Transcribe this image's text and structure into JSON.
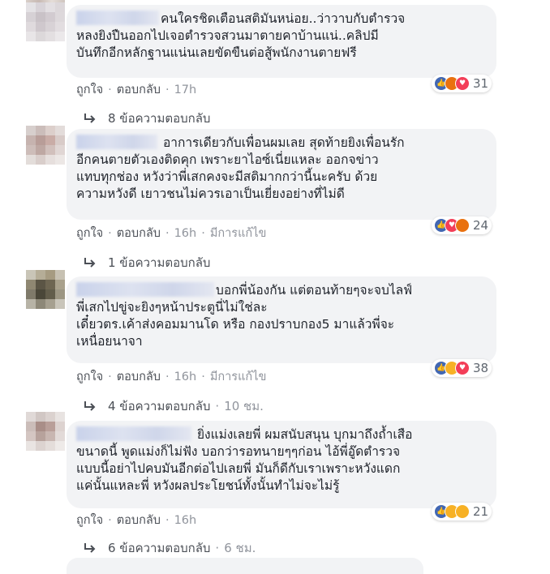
{
  "comments": [
    {
      "text_lines": [
        "คนใครชิดเตือนสติมันหน่อย..ว่าวาบกับตำรวจ",
        "หลงยิงปืนออกไปเจอตำรวจสวนมาตายคาบ้านแน่..คลิปมี",
        "บันทึกอีกหลักฐานแน่นเลยขัดขืนต่อสู้พนักงานตายฟรี"
      ],
      "like_label": "ถูกใจ",
      "reply_label": "ตอบกลับ",
      "time": "17h",
      "edited": "",
      "reactions": [
        "like",
        "angry",
        "love"
      ],
      "reaction_count": "31",
      "replies_label": "8 ข้อความตอบกลับ",
      "replies_time": ""
    },
    {
      "text_lines": [
        "อาการเดียวกับเพื่อนผมเลย สุดท้ายยิงเพื่อนรัก",
        "อีกคนตายตัวเองติดคุก เพราะยาไอซ์เนี่ยแหละ ออกจข่าว",
        "แทบทุกช่อง หวังว่าพี่เสกคงจะมีสติมากกว่านี้นะครับ ด้วย",
        "ความหวังดี เยาวชนไม่ควรเอาเป็นเยี่ยงอย่างที่ไม่ดี"
      ],
      "like_label": "ถูกใจ",
      "reply_label": "ตอบกลับ",
      "time": "16h",
      "edited": "มีการแก้ไข",
      "reactions": [
        "like",
        "love",
        "angry"
      ],
      "reaction_count": "24",
      "replies_label": "1 ข้อความตอบกลับ",
      "replies_time": ""
    },
    {
      "text_lines": [
        "บอกพี่น้องกัน แต่ตอนท้ายๆจะจบไลฟ์",
        "พี่เสกไปขู่จะยิงๆหน้าประตูนี่ไม่ใช่ละ",
        "เดี๋ยวตร.เค้าส่งคอมมานโด หรือ กองปราบกอง5 มาแล้วพี่จะ",
        "เหนื่อยนาจา"
      ],
      "like_label": "ถูกใจ",
      "reply_label": "ตอบกลับ",
      "time": "16h",
      "edited": "มีการแก้ไข",
      "reactions": [
        "like",
        "haha",
        "love"
      ],
      "reaction_count": "38",
      "replies_label": "4 ข้อความตอบกลับ",
      "replies_time": "10 ชม."
    },
    {
      "text_lines": [
        "ยิ่งแม่งเลยพี่ ผมสนับสนุน บุกมาถึงถ้ำเสือ",
        "ขนาดนี้ พูดแม่งก็ไม่ฟัง บอกว่ารอทนายๆๆก่อน ไอ้พี่อู๊ดตำรวจ",
        "แบบนี้อย่าไปคบมันอีกต่อไปเลยพี่ มันก็ดีกับเราเพราะหวังแดก",
        "แค่นั้นแหละพี่ หวังผลประโยชน์ทั้งนั้นทำไม่จะไม่รู้"
      ],
      "like_label": "ถูกใจ",
      "reply_label": "ตอบกลับ",
      "time": "16h",
      "edited": "",
      "reactions": [
        "like",
        "haha",
        "wow"
      ],
      "reaction_count": "21",
      "replies_label": "6 ข้อความตอบกลับ",
      "replies_time": "6 ชม."
    }
  ],
  "colors": {
    "bubble": "#f2f3f5",
    "link": "#4b4f56",
    "meta": "#90949c",
    "like": "#4267b2",
    "love": "#f33e58",
    "angry": "#e9710f",
    "haha": "#f7b125"
  }
}
